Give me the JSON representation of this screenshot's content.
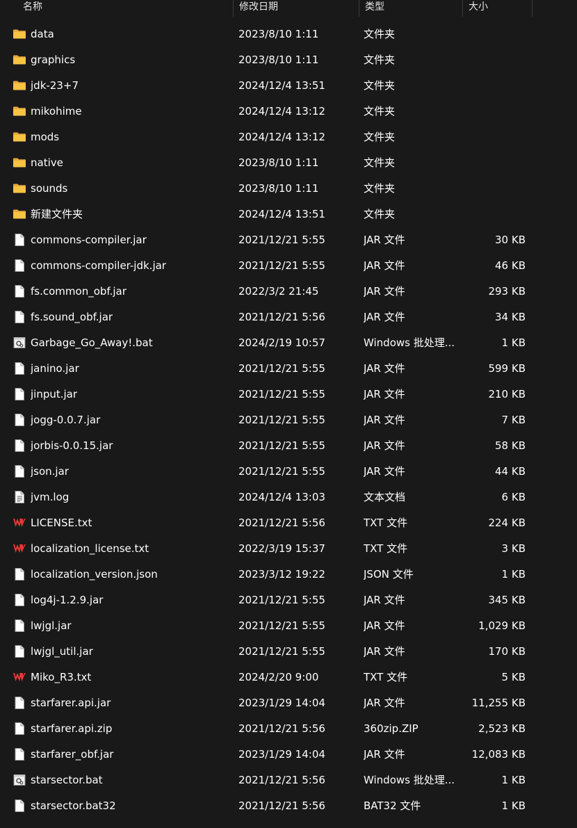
{
  "columns": {
    "name": "名称",
    "date": "修改日期",
    "type": "类型",
    "size": "大小"
  },
  "colors": {
    "background": "#191919",
    "folder": "#f6c343",
    "wps_red": "#e53935"
  },
  "files": [
    {
      "icon": "folder-icon",
      "name": "data",
      "date": "2023/8/10 1:11",
      "type": "文件夹",
      "size": ""
    },
    {
      "icon": "folder-icon",
      "name": "graphics",
      "date": "2023/8/10 1:11",
      "type": "文件夹",
      "size": ""
    },
    {
      "icon": "folder-icon",
      "name": "jdk-23+7",
      "date": "2024/12/4 13:51",
      "type": "文件夹",
      "size": ""
    },
    {
      "icon": "folder-icon",
      "name": "mikohime",
      "date": "2024/12/4 13:12",
      "type": "文件夹",
      "size": ""
    },
    {
      "icon": "folder-icon",
      "name": "mods",
      "date": "2024/12/4 13:12",
      "type": "文件夹",
      "size": ""
    },
    {
      "icon": "folder-icon",
      "name": "native",
      "date": "2023/8/10 1:11",
      "type": "文件夹",
      "size": ""
    },
    {
      "icon": "folder-icon",
      "name": "sounds",
      "date": "2023/8/10 1:11",
      "type": "文件夹",
      "size": ""
    },
    {
      "icon": "folder-icon",
      "name": "新建文件夹",
      "date": "2024/12/4 13:51",
      "type": "文件夹",
      "size": ""
    },
    {
      "icon": "file-icon",
      "name": "commons-compiler.jar",
      "date": "2021/12/21 5:55",
      "type": "JAR 文件",
      "size": "30 KB"
    },
    {
      "icon": "file-icon",
      "name": "commons-compiler-jdk.jar",
      "date": "2021/12/21 5:55",
      "type": "JAR 文件",
      "size": "46 KB"
    },
    {
      "icon": "file-icon",
      "name": "fs.common_obf.jar",
      "date": "2022/3/2 21:45",
      "type": "JAR 文件",
      "size": "293 KB"
    },
    {
      "icon": "file-icon",
      "name": "fs.sound_obf.jar",
      "date": "2021/12/21 5:56",
      "type": "JAR 文件",
      "size": "34 KB"
    },
    {
      "icon": "bat-icon",
      "name": "Garbage_Go_Away!.bat",
      "date": "2024/2/19 10:57",
      "type": "Windows 批处理...",
      "size": "1 KB"
    },
    {
      "icon": "file-icon",
      "name": "janino.jar",
      "date": "2021/12/21 5:55",
      "type": "JAR 文件",
      "size": "599 KB"
    },
    {
      "icon": "file-icon",
      "name": "jinput.jar",
      "date": "2021/12/21 5:55",
      "type": "JAR 文件",
      "size": "210 KB"
    },
    {
      "icon": "file-icon",
      "name": "jogg-0.0.7.jar",
      "date": "2021/12/21 5:55",
      "type": "JAR 文件",
      "size": "7 KB"
    },
    {
      "icon": "file-icon",
      "name": "jorbis-0.0.15.jar",
      "date": "2021/12/21 5:55",
      "type": "JAR 文件",
      "size": "58 KB"
    },
    {
      "icon": "file-icon",
      "name": "json.jar",
      "date": "2021/12/21 5:55",
      "type": "JAR 文件",
      "size": "44 KB"
    },
    {
      "icon": "text-file-icon",
      "name": "jvm.log",
      "date": "2024/12/4 13:03",
      "type": "文本文档",
      "size": "6 KB"
    },
    {
      "icon": "wps-icon",
      "name": "LICENSE.txt",
      "date": "2021/12/21 5:56",
      "type": "TXT 文件",
      "size": "224 KB"
    },
    {
      "icon": "wps-icon",
      "name": "localization_license.txt",
      "date": "2022/3/19 15:37",
      "type": "TXT 文件",
      "size": "3 KB"
    },
    {
      "icon": "file-icon",
      "name": "localization_version.json",
      "date": "2023/3/12 19:22",
      "type": "JSON 文件",
      "size": "1 KB"
    },
    {
      "icon": "file-icon",
      "name": "log4j-1.2.9.jar",
      "date": "2021/12/21 5:55",
      "type": "JAR 文件",
      "size": "345 KB"
    },
    {
      "icon": "file-icon",
      "name": "lwjgl.jar",
      "date": "2021/12/21 5:55",
      "type": "JAR 文件",
      "size": "1,029 KB"
    },
    {
      "icon": "file-icon",
      "name": "lwjgl_util.jar",
      "date": "2021/12/21 5:55",
      "type": "JAR 文件",
      "size": "170 KB"
    },
    {
      "icon": "wps-icon",
      "name": "Miko_R3.txt",
      "date": "2024/2/20 9:00",
      "type": "TXT 文件",
      "size": "5 KB"
    },
    {
      "icon": "file-icon",
      "name": "starfarer.api.jar",
      "date": "2023/1/29 14:04",
      "type": "JAR 文件",
      "size": "11,255 KB"
    },
    {
      "icon": "file-icon",
      "name": "starfarer.api.zip",
      "date": "2021/12/21 5:56",
      "type": "360zip.ZIP",
      "size": "2,523 KB"
    },
    {
      "icon": "file-icon",
      "name": "starfarer_obf.jar",
      "date": "2023/1/29 14:04",
      "type": "JAR 文件",
      "size": "12,083 KB"
    },
    {
      "icon": "bat-icon",
      "name": "starsector.bat",
      "date": "2021/12/21 5:56",
      "type": "Windows 批处理...",
      "size": "1 KB"
    },
    {
      "icon": "file-icon",
      "name": "starsector.bat32",
      "date": "2021/12/21 5:56",
      "type": "BAT32 文件",
      "size": "1 KB"
    }
  ]
}
